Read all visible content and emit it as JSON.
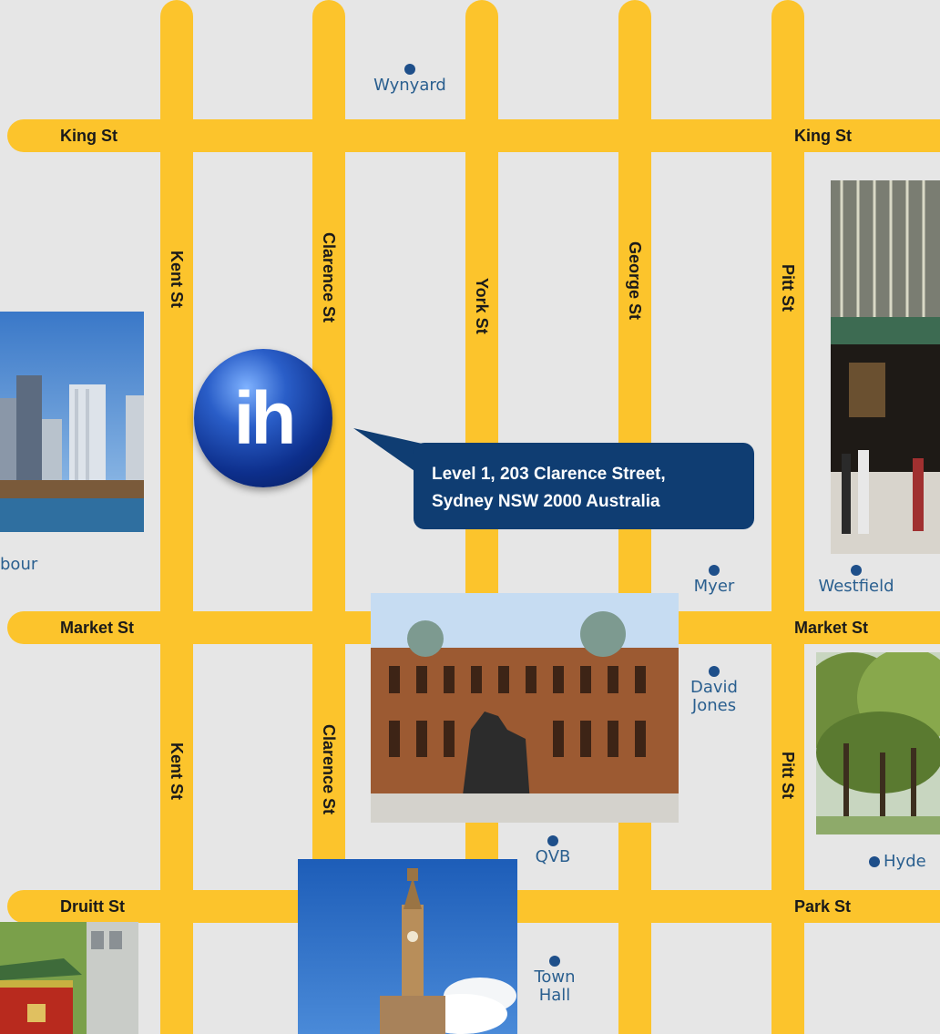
{
  "streets": {
    "horizontal": {
      "king_left": "King St",
      "king_right": "King St",
      "market_left": "Market St",
      "market_right": "Market St",
      "druitt": "Druitt St",
      "park": "Park St"
    },
    "vertical": {
      "kent_top": "Kent St",
      "kent_bottom": "Kent St",
      "clarence_top": "Clarence St",
      "clarence_bottom": "Clarence St",
      "york": "York St",
      "george": "George St",
      "pitt_top": "Pitt St",
      "pitt_bottom": "Pitt St"
    }
  },
  "landmarks": {
    "wynyard": "Wynyard",
    "harbour_partial": "bour",
    "myer": "Myer",
    "westfield": "Westfield",
    "david_jones_line1": "David",
    "david_jones_line2": "Jones",
    "qvb": "QVB",
    "hyde": "Hyde",
    "town_hall_line1": "Town",
    "town_hall_line2": "Hall"
  },
  "logo": {
    "text": "ih"
  },
  "address": {
    "line1": "Level 1, 203 Clarence Street,",
    "line2": "Sydney NSW 2000 Australia"
  },
  "colors": {
    "road": "#fcc42c",
    "background": "#e6e6e6",
    "callout": "#0f3d72",
    "landmark_text": "#2a5f8f",
    "logo": "#0d2f8c"
  }
}
